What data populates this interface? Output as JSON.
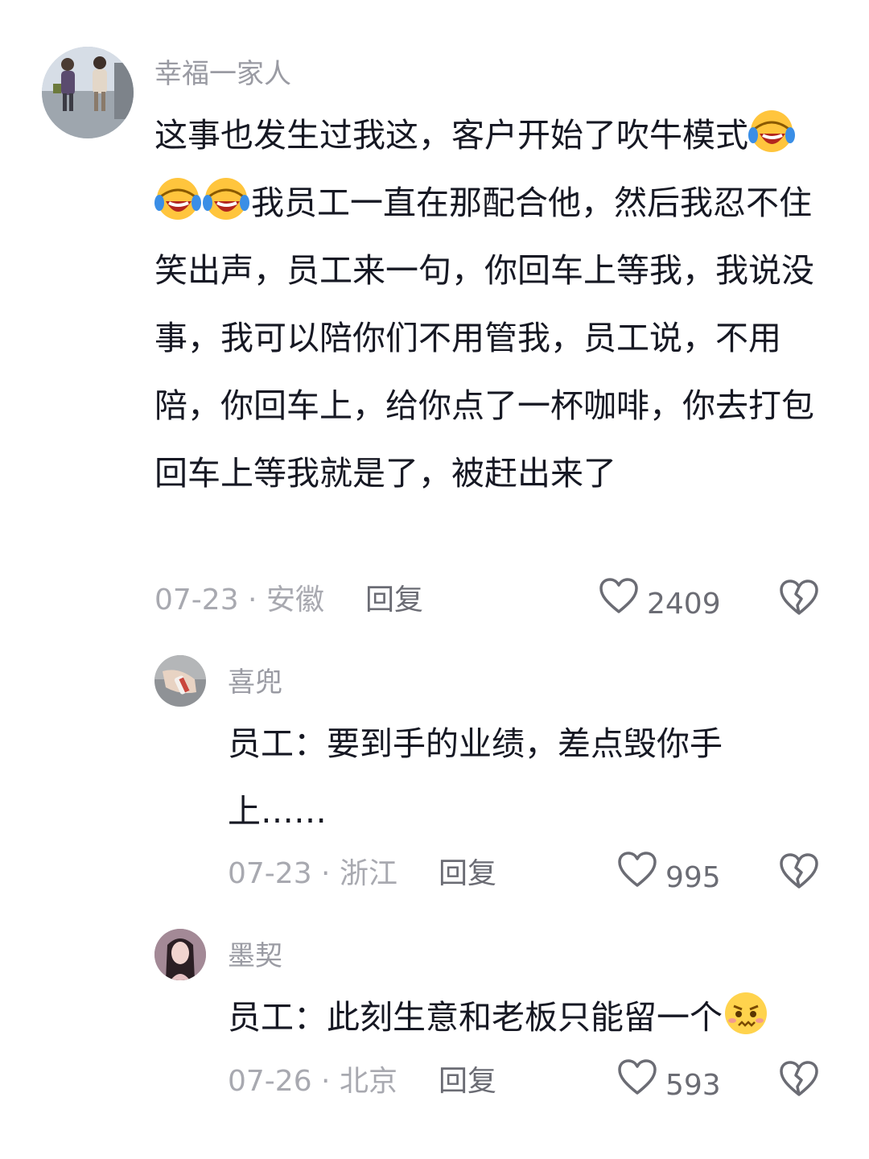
{
  "comments": [
    {
      "username": "幸福一家人",
      "text_part1": "这事也发生过我这，客户开始了吹牛模式",
      "emoji": "laughing-crying-emoji",
      "text_part2": "我员工一直在那配合他，然后我忍不住笑出声，员工来一句，你回车上等我，我说没事，我可以陪你们不用管我，员工说，不用陪，你回车上，给你点了一杯咖啡，你去打包回车上等我就是了，被赶出来了",
      "date": "07-23",
      "location": "安徽",
      "reply_label": "回复",
      "likes": "2409"
    },
    {
      "username": "喜兜",
      "text": "员工：要到手的业绩，差点毁你手上……",
      "date": "07-23",
      "location": "浙江",
      "reply_label": "回复",
      "likes": "995"
    },
    {
      "username": "墨契",
      "text": "员工：此刻生意和老板只能留一个",
      "emoji": "nervous-emoji",
      "date": "07-26",
      "location": "北京",
      "reply_label": "回复",
      "likes": "593"
    }
  ],
  "separator": " · "
}
